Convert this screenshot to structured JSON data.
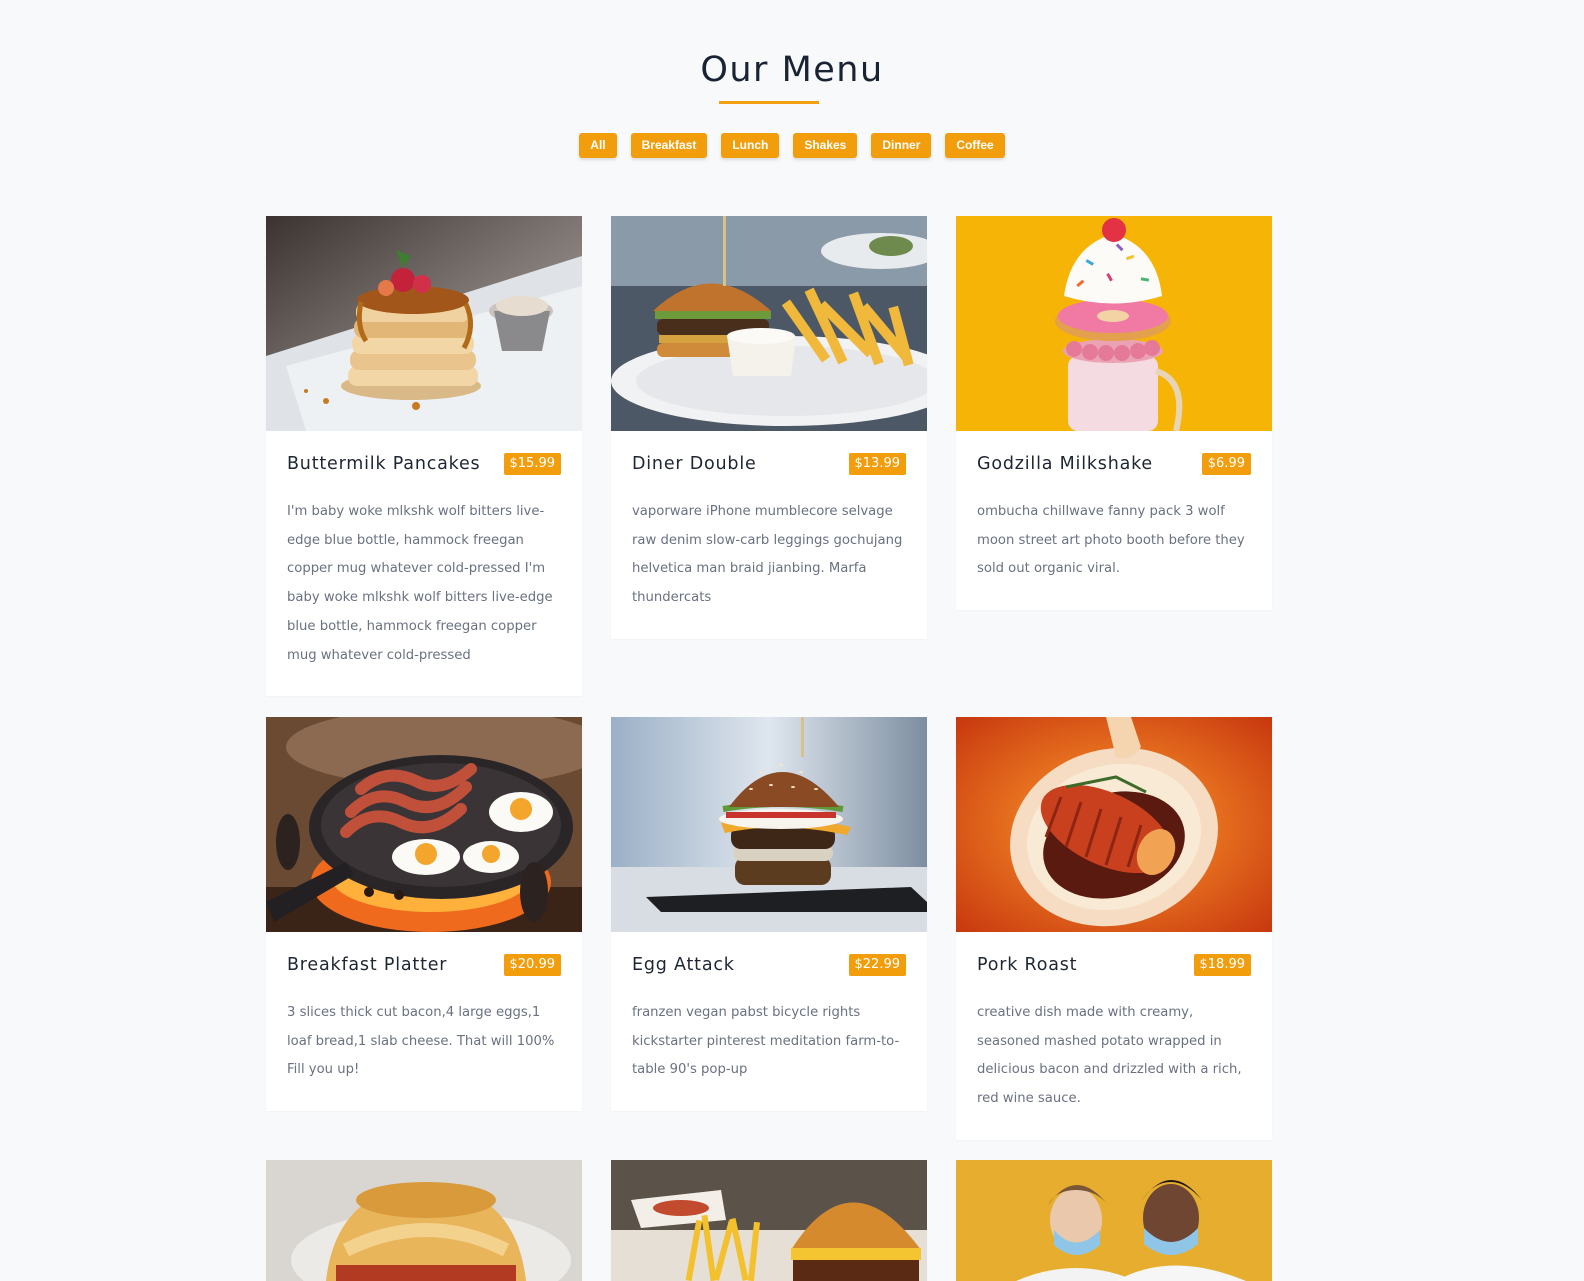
{
  "header": {
    "title": "Our Menu"
  },
  "filters": [
    "All",
    "Breakfast",
    "Lunch",
    "Shakes",
    "Dinner",
    "Coffee"
  ],
  "items": [
    {
      "name": "Buttermilk Pancakes",
      "price": "$15.99",
      "image": "pancakes-photo",
      "desc": "I'm baby woke mlkshk wolf bitters live-edge blue bottle, hammock freegan copper mug whatever cold-pressed I'm baby woke mlkshk wolf bitters live-edge blue bottle, hammock freegan copper mug whatever cold-pressed"
    },
    {
      "name": "Diner Double",
      "price": "$13.99",
      "image": "burger-fries-photo",
      "desc": "vaporware iPhone mumblecore selvage raw denim slow-carb leggings gochujang helvetica man braid jianbing. Marfa thundercats"
    },
    {
      "name": "Godzilla Milkshake",
      "price": "$6.99",
      "image": "milkshake-photo",
      "desc": "ombucha chillwave fanny pack 3 wolf moon street art photo booth before they sold out organic viral."
    },
    {
      "name": "Breakfast Platter",
      "price": "$20.99",
      "image": "bacon-eggs-pan-photo",
      "desc": "3 slices thick cut bacon,4 large eggs,1 loaf bread,1 slab cheese. That will 100% Fill you up!"
    },
    {
      "name": "Egg Attack",
      "price": "$22.99",
      "image": "egg-burger-photo",
      "desc": "franzen vegan pabst bicycle rights kickstarter pinterest meditation farm-to-table 90's pop-up"
    },
    {
      "name": "Pork Roast",
      "price": "$18.99",
      "image": "pork-roast-photo",
      "desc": "creative dish made with creamy, seasoned mashed potato wrapped in delicious bacon and drizzled with a rich, red wine sauce."
    }
  ],
  "partial_items": [
    {
      "image": "biscuit-photo"
    },
    {
      "image": "burger-fries-2-photo"
    },
    {
      "image": "masked-couple-photo"
    }
  ],
  "colors": {
    "accent": "#f29e0c",
    "background": "#f8f9fb",
    "text": "#1f2633",
    "muted": "#6a7181"
  }
}
